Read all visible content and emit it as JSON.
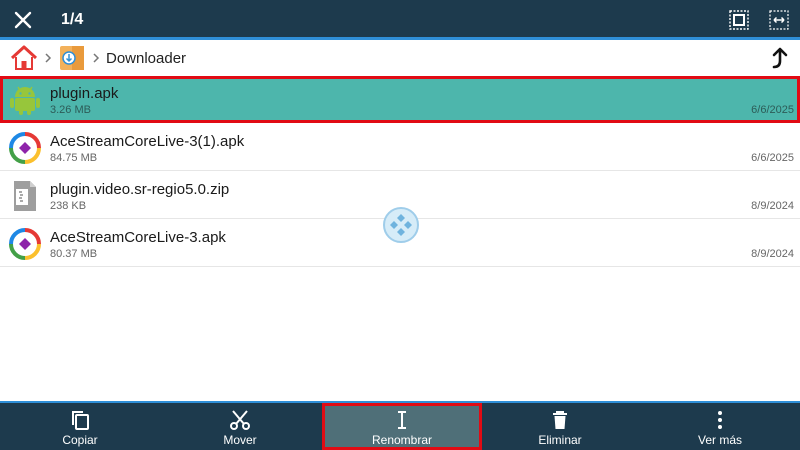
{
  "topbar": {
    "counter": "1/4"
  },
  "path": {
    "current_folder": "Downloader"
  },
  "files": [
    {
      "name": "plugin.apk",
      "size": "3.26 MB",
      "date": "6/6/2025",
      "icon": "android-icon",
      "selected": true
    },
    {
      "name": "AceStreamCoreLive-3(1).apk",
      "size": "84.75 MB",
      "date": "6/6/2025",
      "icon": "acestream-icon",
      "selected": false
    },
    {
      "name": "plugin.video.sr-regio5.0.zip",
      "size": "238 KB",
      "date": "8/9/2024",
      "icon": "zip-file-icon",
      "selected": false
    },
    {
      "name": "AceStreamCoreLive-3.apk",
      "size": "80.37 MB",
      "date": "8/9/2024",
      "icon": "acestream-icon",
      "selected": false
    }
  ],
  "actions": [
    {
      "label": "Copiar",
      "icon": "copy-icon"
    },
    {
      "label": "Mover",
      "icon": "scissors-icon"
    },
    {
      "label": "Renombrar",
      "icon": "text-cursor-icon"
    },
    {
      "label": "Eliminar",
      "icon": "trash-icon"
    },
    {
      "label": "Ver más",
      "icon": "more-vert-icon"
    }
  ],
  "colors": {
    "bar_bg": "#1d3a4d",
    "accent_blue": "#2f8fd8",
    "selected_row": "#4db6ac",
    "highlight_red": "#e10b14"
  }
}
